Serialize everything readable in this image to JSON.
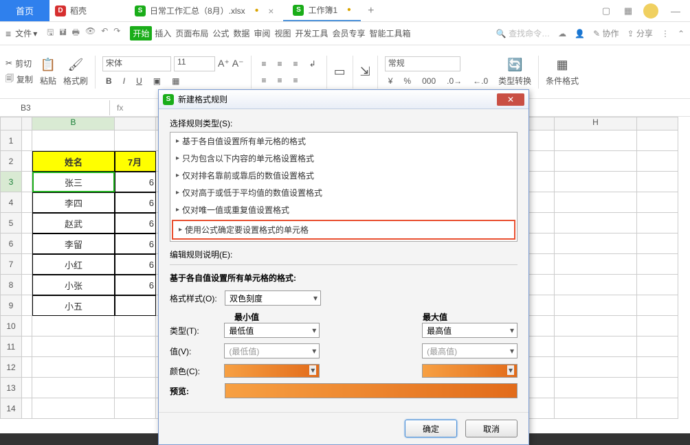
{
  "titlebar": {
    "home": "首页",
    "shell": "稻壳",
    "tab1": "日常工作汇总（8月）.xlsx",
    "tab2": "工作簿1",
    "add": "+"
  },
  "menubar": {
    "file": "文件",
    "tabs": [
      "开始",
      "插入",
      "页面布局",
      "公式",
      "数据",
      "审阅",
      "视图",
      "开发工具",
      "会员专享",
      "智能工具箱"
    ],
    "search_placeholder": "查找命令…",
    "collab": "协作",
    "share": "分享"
  },
  "ribbon": {
    "cut": "剪切",
    "paste": "粘贴",
    "copy": "复制",
    "brush": "格式刷",
    "font": "宋体",
    "size": "11",
    "numfmt": "常规",
    "typeconv": "类型转换",
    "condfmt": "条件格式"
  },
  "namerow": {
    "ref": "B3",
    "fx": "fx"
  },
  "sheet": {
    "colB": "B",
    "colH": "H",
    "headerB": "姓名",
    "headerC": "7月",
    "rows": [
      {
        "n": "1",
        "b": "",
        "c": ""
      },
      {
        "n": "2",
        "b": "姓名",
        "c": "7月"
      },
      {
        "n": "3",
        "b": "张三",
        "c": "6"
      },
      {
        "n": "4",
        "b": "李四",
        "c": "6"
      },
      {
        "n": "5",
        "b": "赵武",
        "c": "6"
      },
      {
        "n": "6",
        "b": "李留",
        "c": "6"
      },
      {
        "n": "7",
        "b": "小红",
        "c": "6"
      },
      {
        "n": "8",
        "b": "小张",
        "c": "6"
      },
      {
        "n": "9",
        "b": "小五",
        "c": ""
      }
    ]
  },
  "dialog": {
    "title": "新建格式规则",
    "select_label": "选择规则类型(S):",
    "rules": [
      "基于各自值设置所有单元格的格式",
      "只为包含以下内容的单元格设置格式",
      "仅对排名靠前或靠后的数值设置格式",
      "仅对高于或低于平均值的数值设置格式",
      "仅对唯一值或重复值设置格式",
      "使用公式确定要设置格式的单元格"
    ],
    "edit_label": "编辑规则说明(E):",
    "section_title": "基于各自值设置所有单元格的格式:",
    "style_label": "格式样式(O):",
    "style_value": "双色刻度",
    "min_header": "最小值",
    "max_header": "最大值",
    "type_label": "类型(T):",
    "type_min": "最低值",
    "type_max": "最高值",
    "value_label": "值(V):",
    "value_min": "(最低值)",
    "value_max": "(最高值)",
    "color_label": "颜色(C):",
    "preview_label": "预览:",
    "ok": "确定",
    "cancel": "取消"
  }
}
